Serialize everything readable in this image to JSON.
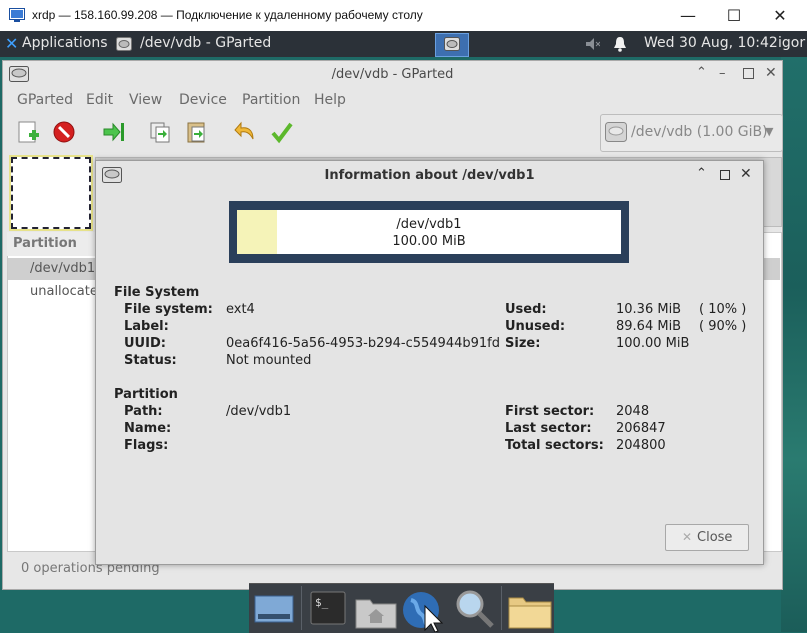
{
  "rdp_window": {
    "title": "xrdp — 158.160.99.208 — Подключение к удаленному рабочему столу",
    "buttons": [
      "—",
      "☐",
      "✕"
    ]
  },
  "panel": {
    "applications_label": "Applications",
    "task_label": "/dev/vdb - GParted",
    "clock": "Wed 30 Aug, 10:42",
    "user": "igor"
  },
  "gparted": {
    "title": "/dev/vdb - GParted",
    "menu": [
      "GParted",
      "Edit",
      "View",
      "Device",
      "Partition",
      "Help"
    ],
    "device_selector": "/dev/vdb (1.00 GiB)",
    "partition_list": {
      "header": "Partition",
      "rows": [
        "/dev/vdb1",
        "unallocated"
      ]
    },
    "status": "0 operations pending"
  },
  "dialog": {
    "title": "Information about /dev/vdb1",
    "graph": {
      "name": "/dev/vdb1",
      "size": "100.00 MiB",
      "used_fraction": 0.1036
    },
    "file_system": {
      "section": "File System",
      "fields": [
        {
          "label": "File system:",
          "value": "ext4"
        },
        {
          "label": "Label:",
          "value": ""
        },
        {
          "label": "UUID:",
          "value": "0ea6f416-5a56-4953-b294-c554944b91fd"
        },
        {
          "label": "Status:",
          "value": "Not mounted"
        }
      ],
      "usage": [
        {
          "label": "Used:",
          "value": "10.36 MiB",
          "percent": "( 10% )"
        },
        {
          "label": "Unused:",
          "value": "89.64 MiB",
          "percent": "( 90% )"
        },
        {
          "label": "Size:",
          "value": "100.00 MiB",
          "percent": ""
        }
      ]
    },
    "partition": {
      "section": "Partition",
      "fields": [
        {
          "label": "Path:",
          "value": "/dev/vdb1"
        },
        {
          "label": "Name:",
          "value": ""
        },
        {
          "label": "Flags:",
          "value": ""
        }
      ],
      "sectors": [
        {
          "label": "First sector:",
          "value": "2048"
        },
        {
          "label": "Last sector:",
          "value": "206847"
        },
        {
          "label": "Total sectors:",
          "value": "204800"
        }
      ]
    },
    "close_label": "Close"
  }
}
